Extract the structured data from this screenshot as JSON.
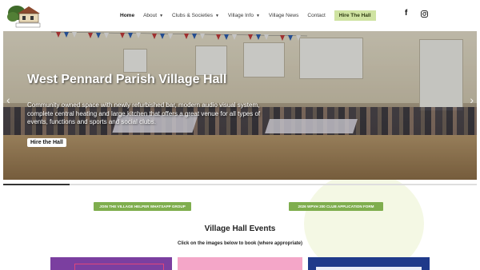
{
  "header": {
    "logo_text": "West Pennard Village Hall",
    "nav": [
      {
        "label": "Home",
        "active": true,
        "dropdown": false
      },
      {
        "label": "About",
        "active": false,
        "dropdown": true
      },
      {
        "label": "Clubs & Societies",
        "active": false,
        "dropdown": true
      },
      {
        "label": "Village Info",
        "active": false,
        "dropdown": true
      },
      {
        "label": "Village News",
        "active": false,
        "dropdown": false
      },
      {
        "label": "Contact",
        "active": false,
        "dropdown": false
      }
    ],
    "hire_button": "Hire The Hall",
    "social_icons": [
      "facebook-icon",
      "instagram-icon"
    ]
  },
  "hero": {
    "title": "West Pennard Parish Village Hall",
    "description": "Community owned space with newly refurbished bar, modern audio visual system, complete central heating and large kitchen that offers a great venue for all types of events, functions and sports and social clubs.",
    "button": "Hire the Hall",
    "slider_progress": 0.14
  },
  "buttons": {
    "whatsapp": "JOIN THE VILLAGE HELPER WHATSAPP GROUP",
    "club_form": "2026 WPVH 200 CLUB APPLICATION FORM"
  },
  "events": {
    "title": "Village Hall Events",
    "subtitle": "Click on the images below to book (where appropriate)"
  },
  "colors": {
    "accent_green": "#7fae4e",
    "hire_button_bg": "#cfe3a2",
    "card_purple": "#7b3fa0",
    "card_pink": "#f4a6c8",
    "card_navy": "#1f3a8a"
  }
}
